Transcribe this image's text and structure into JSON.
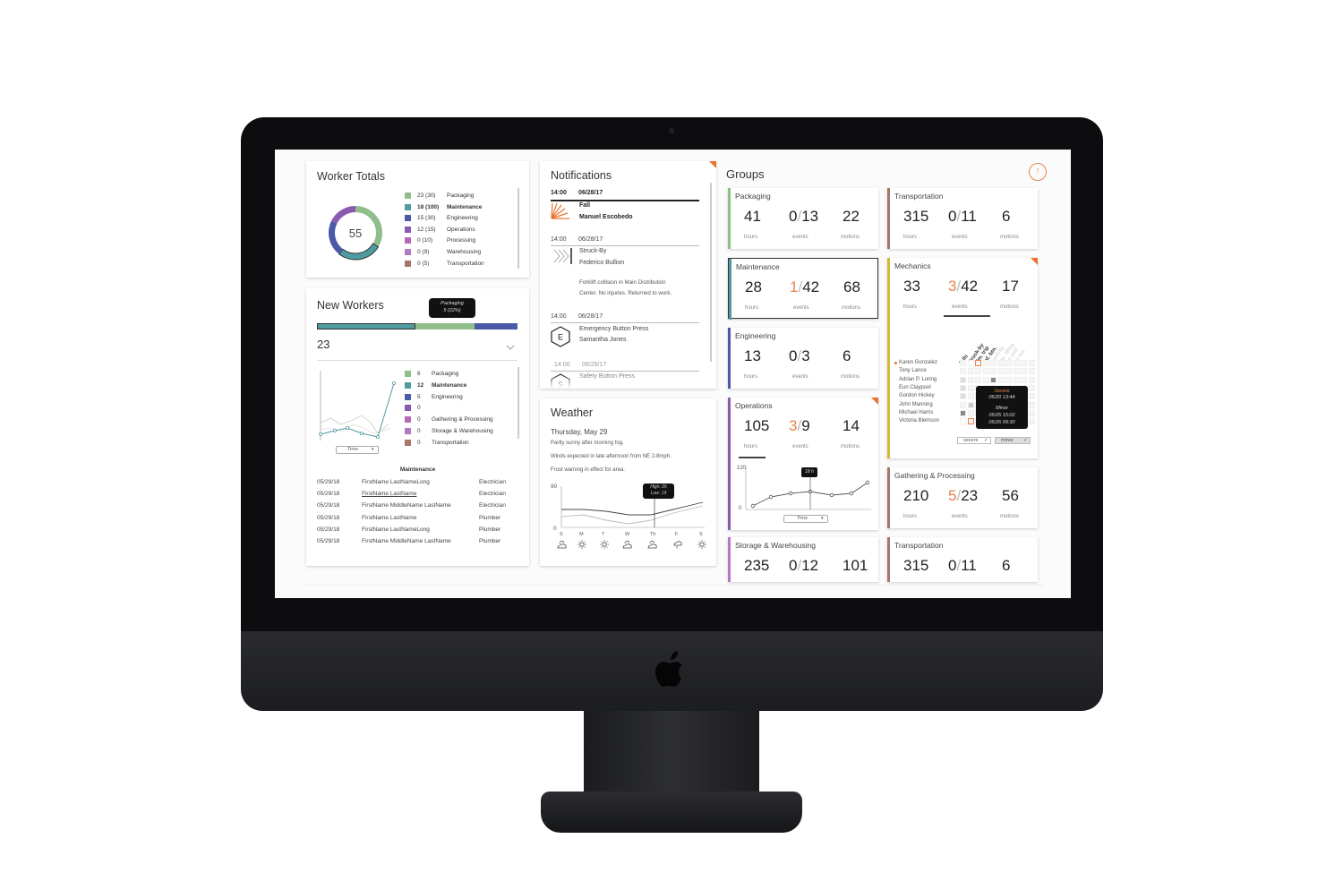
{
  "colors": {
    "packaging": "#8fbe8b",
    "maintenance": "#4e9ba0",
    "engineering": "#4a5aa6",
    "operations": "#8a5ab0",
    "processing": "#b56ab8",
    "warehousing": "#b27ac2",
    "transportation": "#a8776a",
    "accent": "#e8732f"
  },
  "worker_totals": {
    "title": "Worker Totals",
    "total": "55",
    "legend": [
      {
        "count": "23 (30)",
        "label": "Packaging",
        "bold": false
      },
      {
        "count": "18 (100)",
        "label": "Maintenance",
        "bold": true
      },
      {
        "count": "15 (30)",
        "label": "Engineering",
        "bold": false
      },
      {
        "count": "12 (15)",
        "label": "Operations",
        "bold": false
      },
      {
        "count": "0 (10)",
        "label": "Processing",
        "bold": false
      },
      {
        "count": "0 (9)",
        "label": "Warehousing",
        "bold": false
      },
      {
        "count": "0 (5)",
        "label": "Transportation",
        "bold": false
      }
    ]
  },
  "new_workers": {
    "title": "New Workers",
    "tooltip_label": "Packaging",
    "tooltip_value": "5 (22%)",
    "count": "23",
    "legend": [
      {
        "count": "6",
        "label": "Packaging"
      },
      {
        "count": "12",
        "label": "Maintenance"
      },
      {
        "count": "5",
        "label": "Engineering"
      },
      {
        "count": "0",
        "label": ""
      },
      {
        "count": "0",
        "label": "Gathering & Processing"
      },
      {
        "count": "0",
        "label": "Storage & Warehousing"
      },
      {
        "count": "0",
        "label": "Transportation"
      }
    ],
    "time_select": "Time",
    "table_title": "Maintenance",
    "rows": [
      {
        "date": "05/29/18",
        "name": "FirstName LastNameLong",
        "role": "Electrician",
        "link": false
      },
      {
        "date": "05/29/18",
        "name": "FirstName LastName",
        "role": "Electrician",
        "link": true
      },
      {
        "date": "05/29/18",
        "name": "FirstName MiddleName LastName",
        "role": "Electrician",
        "link": false
      },
      {
        "date": "05/29/18",
        "name": "FirstName LastName",
        "role": "Plumber",
        "link": false
      },
      {
        "date": "05/29/18",
        "name": "FirstName LastNameLong",
        "role": "Plumber",
        "link": false
      },
      {
        "date": "05/29/18",
        "name": "FirstName MiddleName LastName",
        "role": "Plumber",
        "link": false
      }
    ]
  },
  "notifications": {
    "title": "Notifications",
    "items": [
      {
        "time": "14:00",
        "date": "06/28/17",
        "type": "Fall",
        "person": "Manuel Escobedo",
        "desc1": "",
        "desc2": "",
        "icon_letter": ""
      },
      {
        "time": "14:00",
        "date": "06/28/17",
        "type": "Struck-By",
        "person": "Federico Bullion",
        "desc1": "Forklift collision in Main Distribution",
        "desc2": "Center. No injuries. Returned to work.",
        "icon_letter": ""
      },
      {
        "time": "14:00",
        "date": "06/28/17",
        "type": "Emergency Button Press",
        "person": "Samantha Jones",
        "desc1": "",
        "desc2": "",
        "icon_letter": "E"
      },
      {
        "time": "14:00",
        "date": "06/28/17",
        "type": "Safety Button Press",
        "person": "",
        "desc1": "",
        "desc2": "",
        "icon_letter": "S"
      }
    ]
  },
  "weather": {
    "title": "Weather",
    "date": "Thursday, May 29",
    "line1": "Partly sunny after morning fog.",
    "line2": "Winds expected in late afternoon from NE 2-8mph.",
    "line3": "Frost warning in effect for area.",
    "y_top": "90",
    "y_bottom": "0",
    "tooltip_high": "High: 26",
    "tooltip_low": "Low: 19",
    "days": [
      "S",
      "M",
      "T",
      "W",
      "Th",
      "F",
      "S"
    ]
  },
  "groups": {
    "title": "Groups",
    "alert_symbol": "!",
    "hours_label": "hours",
    "events_label": "events",
    "motions_label": "motions",
    "cards": [
      {
        "name": "Packaging",
        "hours": "41",
        "ev_a": "0",
        "ev_b": "13",
        "motions": "22",
        "hl": false
      },
      {
        "name": "Transportation",
        "hours": "315",
        "ev_a": "0",
        "ev_b": "11",
        "motions": "6",
        "hl": false
      },
      {
        "name": "Maintenance",
        "hours": "28",
        "ev_a": "1",
        "ev_b": "42",
        "motions": "68",
        "hl": true
      },
      {
        "name": "Mechanics",
        "hours": "33",
        "ev_a": "3",
        "ev_b": "42",
        "motions": "17",
        "hl": true
      },
      {
        "name": "Engineering",
        "hours": "13",
        "ev_a": "0",
        "ev_b": "3",
        "motions": "6",
        "hl": false
      },
      {
        "name": "Operations",
        "hours": "105",
        "ev_a": "3",
        "ev_b": "9",
        "motions": "14",
        "hl": true
      },
      {
        "name": "Gathering & Processing",
        "hours": "210",
        "ev_a": "5",
        "ev_b": "23",
        "motions": "56",
        "hl": true
      },
      {
        "name": "Storage & Warehousing",
        "hours": "235",
        "ev_a": "0",
        "ev_b": "12",
        "motions": "101",
        "hl": false
      },
      {
        "name": "Transportation",
        "hours": "315",
        "ev_a": "0",
        "ev_b": "11",
        "motions": "6",
        "hl": false
      }
    ],
    "operations_chart": {
      "y_top": "120",
      "y_bottom": "0",
      "tooltip": "18 h",
      "time_select": "Time"
    },
    "mechanics_detail": {
      "columns": [
        "falls",
        "struck-by",
        "sim. trip",
        "saf. btn.",
        "inactivity",
        "imp. lifting",
        "too cold",
        "too hot"
      ],
      "people": [
        "Karen Gonzalez",
        "Tony Lance",
        "Adrian P. Loring",
        "Eun Claypool",
        "Gordon Hickey",
        "John Manning",
        "Michael Harris",
        "Victoria Blemson"
      ],
      "tip_severe": "Severe",
      "tip_severe_time": "05/20 13:44",
      "tip_minor": "Minor",
      "tip_minor_t1": "05/25 15:02",
      "tip_minor_t2": "05/26 09:30",
      "filter_severe": "severe",
      "filter_minor": "minor"
    }
  }
}
